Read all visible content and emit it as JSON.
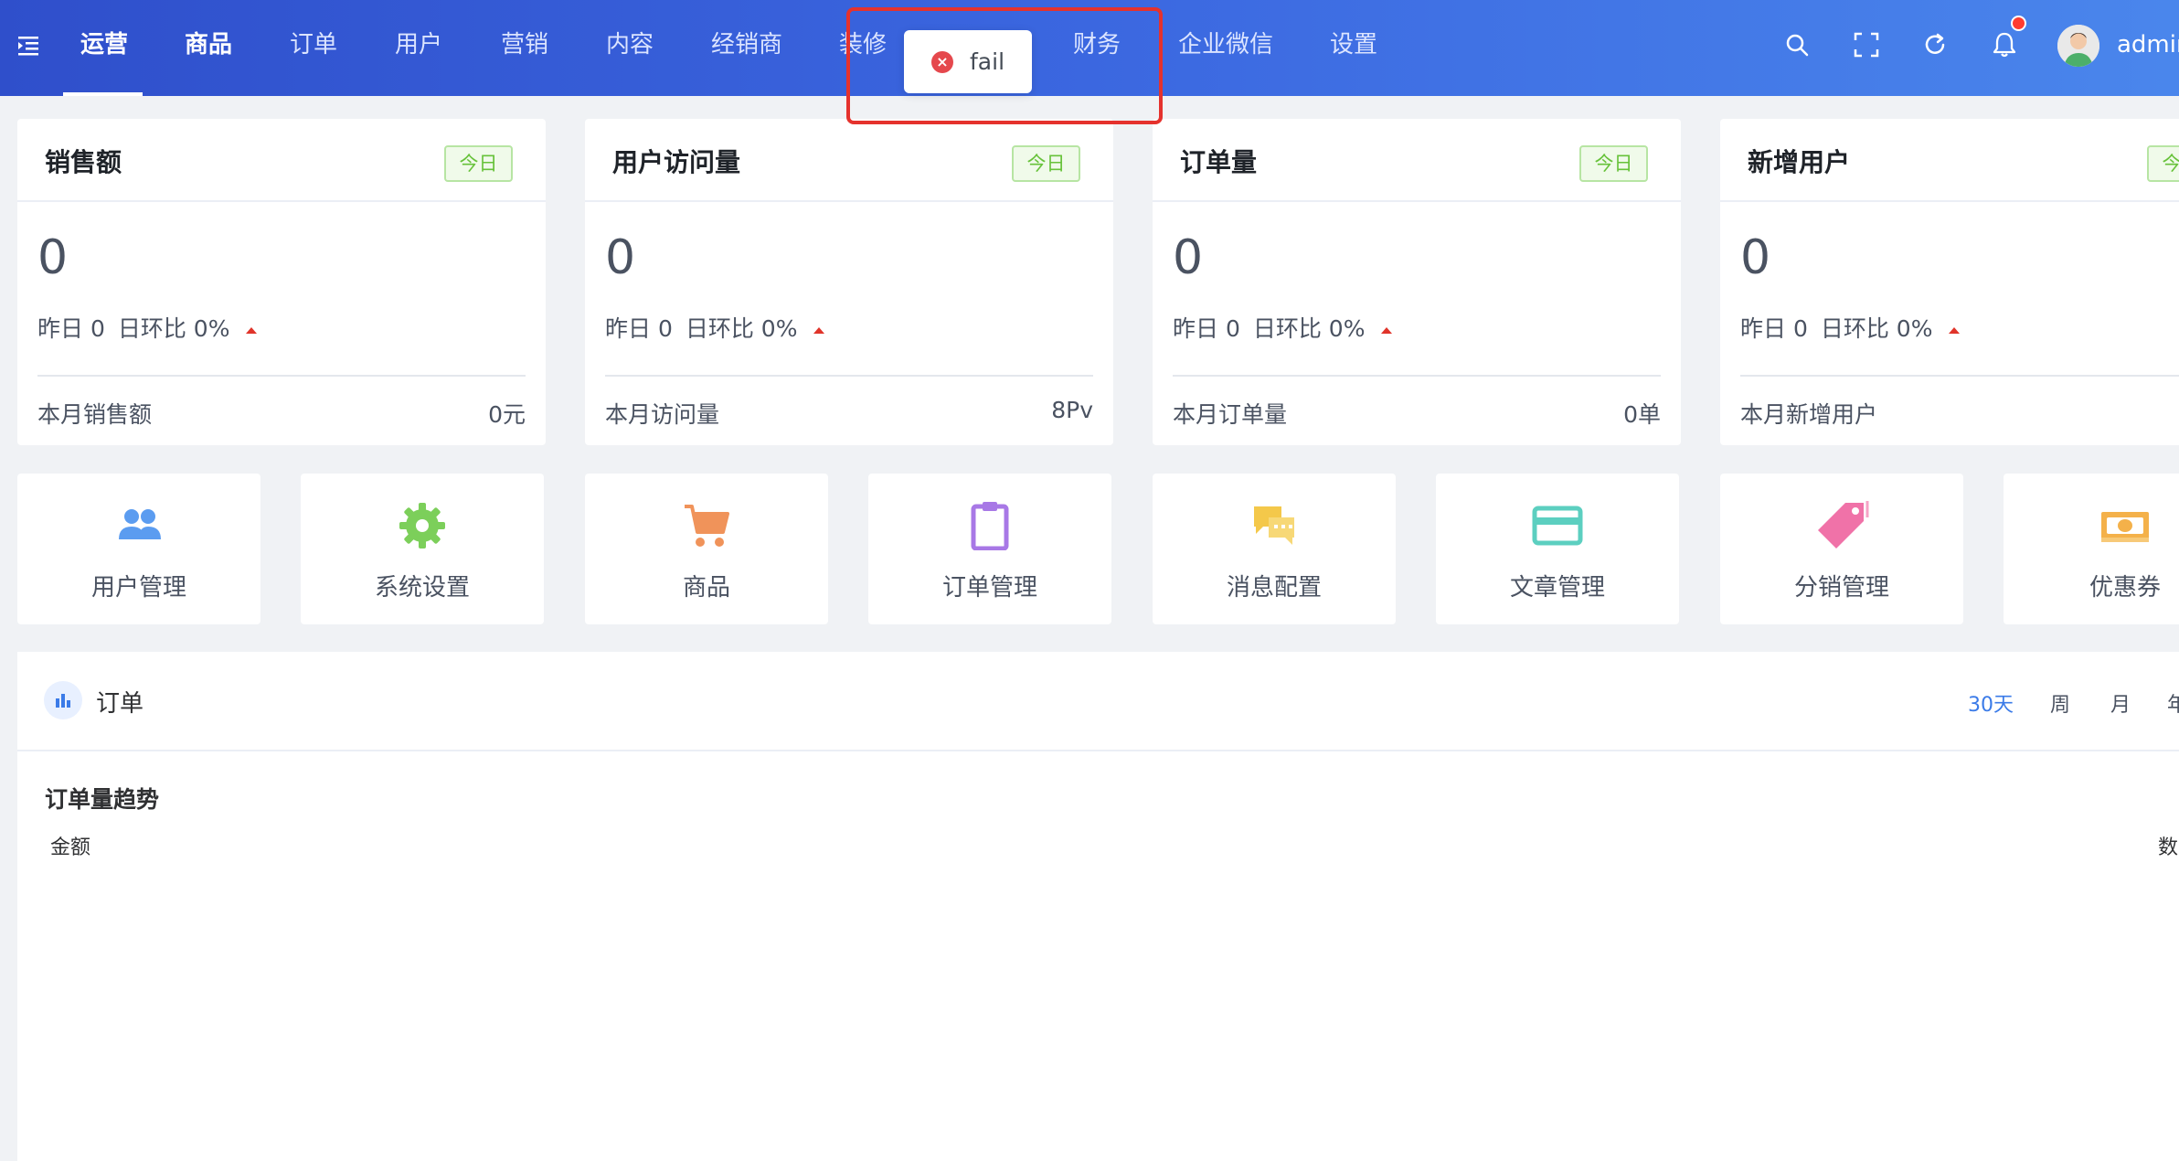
{
  "header": {
    "nav": [
      {
        "label": "运营"
      },
      {
        "label": "商品"
      },
      {
        "label": "订单"
      },
      {
        "label": "用户"
      },
      {
        "label": "营销"
      },
      {
        "label": "内容"
      },
      {
        "label": "经销商"
      },
      {
        "label": "装修"
      },
      {
        "label": "财务"
      },
      {
        "label": "企业微信"
      },
      {
        "label": "设置"
      }
    ],
    "icons": [
      "menu-fold-icon",
      "search-icon",
      "fullscreen-icon",
      "refresh-icon",
      "bell-icon"
    ],
    "username": "admin"
  },
  "toast": {
    "type": "error",
    "icon": "close-circle-icon",
    "message": "fail"
  },
  "stats": [
    {
      "title": "销售额",
      "tag": "今日",
      "value": "0",
      "yesterday": "昨日 0",
      "ratio": "日环比 0%",
      "month_label": "本月销售额",
      "month_value": "0元"
    },
    {
      "title": "用户访问量",
      "tag": "今日",
      "value": "0",
      "yesterday": "昨日 0",
      "ratio": "日环比 0%",
      "month_label": "本月访问量",
      "month_value": "8Pv"
    },
    {
      "title": "订单量",
      "tag": "今日",
      "value": "0",
      "yesterday": "昨日 0",
      "ratio": "日环比 0%",
      "month_label": "本月订单量",
      "month_value": "0单"
    },
    {
      "title": "新增用户",
      "tag": "今日",
      "value": "0",
      "yesterday": "昨日 0",
      "ratio": "日环比 0%",
      "month_label": "本月新增用户",
      "month_value": ""
    }
  ],
  "quick_menu": [
    {
      "label": "用户管理",
      "icon": "users-icon",
      "color": "#5b9cf0"
    },
    {
      "label": "系统设置",
      "icon": "gear-icon",
      "color": "#7ccf5a"
    },
    {
      "label": "商品",
      "icon": "cart-icon",
      "color": "#f0935a"
    },
    {
      "label": "订单管理",
      "icon": "clipboard-icon",
      "color": "#a878e6"
    },
    {
      "label": "消息配置",
      "icon": "chat-icon",
      "color": "#f4c84a"
    },
    {
      "label": "文章管理",
      "icon": "card-icon",
      "color": "#5ccfc0"
    },
    {
      "label": "分销管理",
      "icon": "tag-icon",
      "color": "#f072a8"
    },
    {
      "label": "优惠券",
      "icon": "coupon-icon",
      "color": "#f4b14a"
    }
  ],
  "order_panel": {
    "title": "订单",
    "ranges": [
      "30天",
      "周",
      "月",
      "年"
    ],
    "active_range": "30天",
    "trend_title": "订单量趋势",
    "axis_left": "金额",
    "axis_right": "数"
  },
  "colors": {
    "header_start": "#2f4fcb",
    "header_end": "#4a86ec",
    "accent": "#3b7be8",
    "tag_green": "#67c23a",
    "error": "#e5322d"
  }
}
